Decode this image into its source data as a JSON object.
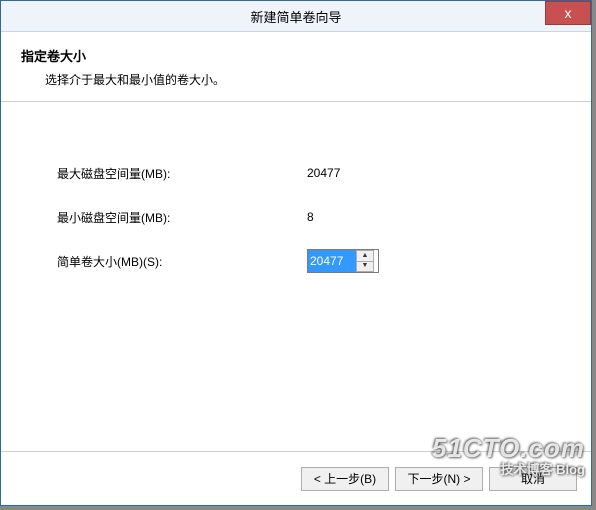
{
  "titlebar": {
    "title": "新建简单卷向导",
    "close_glyph": "x"
  },
  "header": {
    "title": "指定卷大小",
    "description": "选择介于最大和最小值的卷大小。"
  },
  "fields": {
    "max_space": {
      "label": "最大磁盘空间量(MB):",
      "value": "20477"
    },
    "min_space": {
      "label": "最小磁盘空间量(MB):",
      "value": "8"
    },
    "simple_size": {
      "label": "简单卷大小(MB)(S):",
      "value": "20477"
    }
  },
  "footer": {
    "back": "< 上一步(B)",
    "next": "下一步(N) >",
    "cancel": "取消"
  },
  "watermark": {
    "line1": "51CTO.com",
    "line2": "技术博客 Blog"
  }
}
